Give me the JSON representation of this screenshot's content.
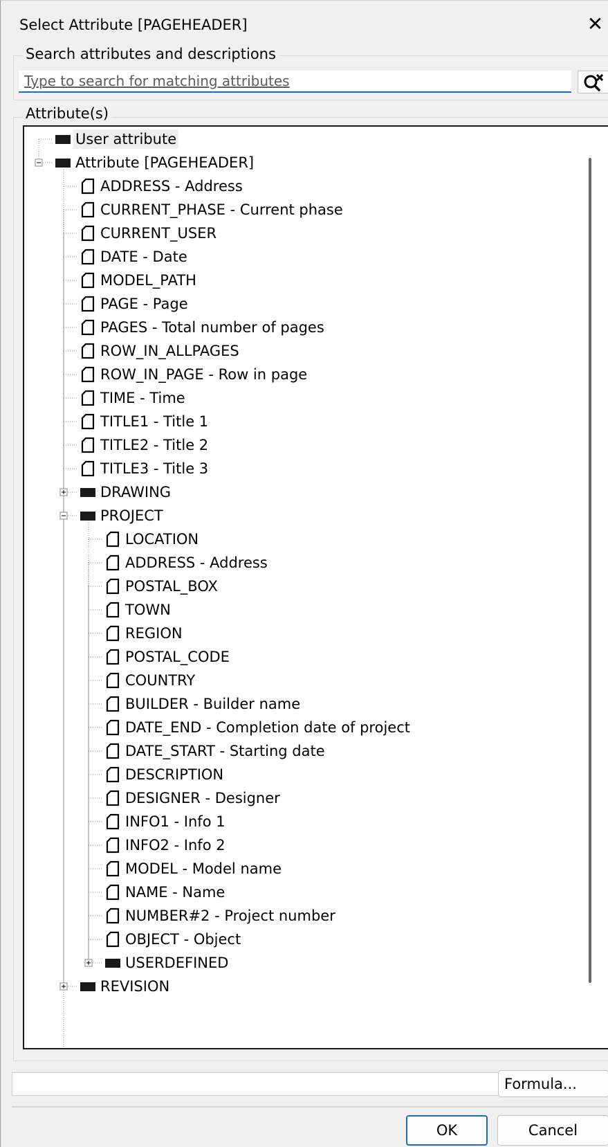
{
  "dialog": {
    "title": "Select Attribute [PAGEHEADER]",
    "close_glyph": "✕"
  },
  "search": {
    "group_label": "Search attributes and descriptions",
    "placeholder": "Type to search for matching attributes",
    "value": "",
    "button_icon": "clear-search-icon"
  },
  "attributes": {
    "group_label": "Attribute(s)",
    "nodes": [
      {
        "label": "User attribute",
        "type": "folder",
        "level": 0,
        "expander": "none",
        "selected": true
      },
      {
        "label": "Attribute [PAGEHEADER]",
        "type": "folder",
        "level": 0,
        "expander": "minus"
      },
      {
        "label": "ADDRESS  -  Address",
        "type": "item",
        "level": 1
      },
      {
        "label": "CURRENT_PHASE  -  Current phase",
        "type": "item",
        "level": 1
      },
      {
        "label": "CURRENT_USER",
        "type": "item",
        "level": 1
      },
      {
        "label": "DATE  -  Date",
        "type": "item",
        "level": 1
      },
      {
        "label": "MODEL_PATH",
        "type": "item",
        "level": 1
      },
      {
        "label": "PAGE  -  Page",
        "type": "item",
        "level": 1
      },
      {
        "label": "PAGES  -  Total number of pages",
        "type": "item",
        "level": 1
      },
      {
        "label": "ROW_IN_ALLPAGES",
        "type": "item",
        "level": 1
      },
      {
        "label": "ROW_IN_PAGE  -  Row in page",
        "type": "item",
        "level": 1
      },
      {
        "label": "TIME  -  Time",
        "type": "item",
        "level": 1
      },
      {
        "label": "TITLE1  -  Title 1",
        "type": "item",
        "level": 1
      },
      {
        "label": "TITLE2  -  Title 2",
        "type": "item",
        "level": 1
      },
      {
        "label": "TITLE3  -  Title 3",
        "type": "item",
        "level": 1
      },
      {
        "label": "DRAWING",
        "type": "folder",
        "level": 1,
        "expander": "plus"
      },
      {
        "label": "PROJECT",
        "type": "folder",
        "level": 1,
        "expander": "minus"
      },
      {
        "label": "LOCATION",
        "type": "item",
        "level": 2
      },
      {
        "label": "ADDRESS  -  Address",
        "type": "item",
        "level": 2
      },
      {
        "label": "POSTAL_BOX",
        "type": "item",
        "level": 2
      },
      {
        "label": "TOWN",
        "type": "item",
        "level": 2
      },
      {
        "label": "REGION",
        "type": "item",
        "level": 2
      },
      {
        "label": "POSTAL_CODE",
        "type": "item",
        "level": 2
      },
      {
        "label": "COUNTRY",
        "type": "item",
        "level": 2
      },
      {
        "label": "BUILDER  -  Builder name",
        "type": "item",
        "level": 2
      },
      {
        "label": "DATE_END  -  Completion date of project",
        "type": "item",
        "level": 2
      },
      {
        "label": "DATE_START  -  Starting date",
        "type": "item",
        "level": 2
      },
      {
        "label": "DESCRIPTION",
        "type": "item",
        "level": 2
      },
      {
        "label": "DESIGNER  -  Designer",
        "type": "item",
        "level": 2
      },
      {
        "label": "INFO1  -  Info 1",
        "type": "item",
        "level": 2
      },
      {
        "label": "INFO2  -  Info 2",
        "type": "item",
        "level": 2
      },
      {
        "label": "MODEL  -  Model name",
        "type": "item",
        "level": 2
      },
      {
        "label": "NAME  -  Name",
        "type": "item",
        "level": 2
      },
      {
        "label": "NUMBER#2  -  Project number",
        "type": "item",
        "level": 2
      },
      {
        "label": "OBJECT  -  Object",
        "type": "item",
        "level": 2
      },
      {
        "label": "USERDEFINED",
        "type": "folder",
        "level": 2,
        "expander": "plus"
      },
      {
        "label": "REVISION",
        "type": "folder",
        "level": 1,
        "expander": "plus"
      }
    ]
  },
  "formula": {
    "value": "",
    "button_label": "Formula..."
  },
  "footer": {
    "ok_label": "OK",
    "cancel_label": "Cancel"
  },
  "colors": {
    "dialog_bg": "#f0f0f0",
    "accent": "#1d6bc8",
    "tree_bg": "#ffffff"
  }
}
